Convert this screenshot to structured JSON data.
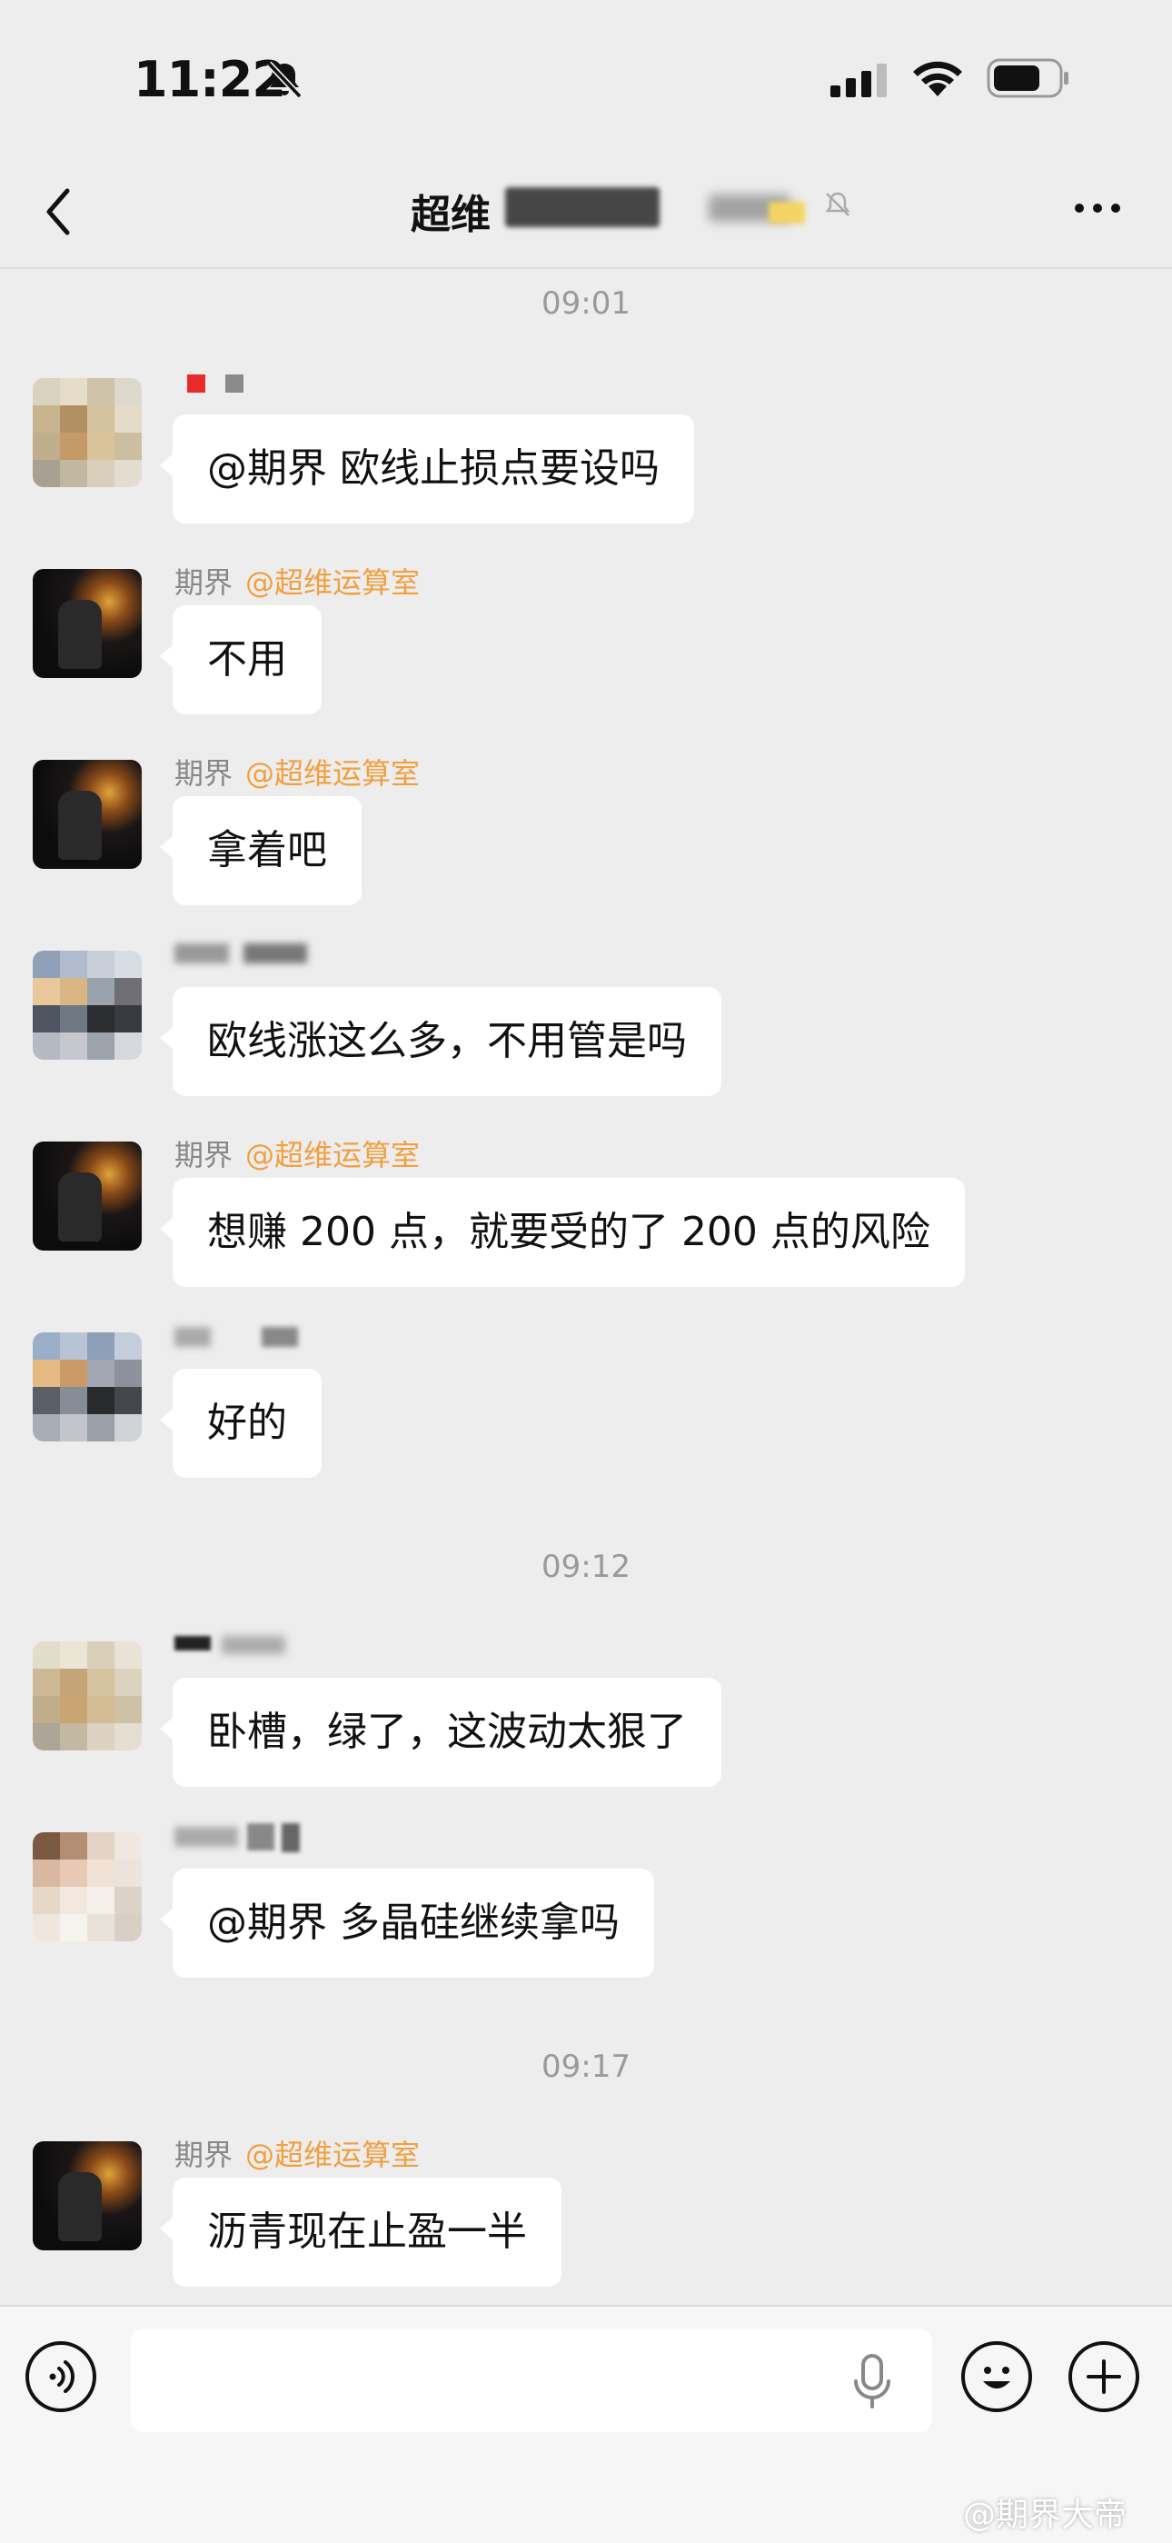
{
  "status_bar": {
    "time": "11:22",
    "icons": [
      "bell-slash-icon",
      "signal-icon",
      "wifi-icon",
      "battery-icon"
    ]
  },
  "nav": {
    "title_visible": "超维",
    "back_icon": "chevron-left-icon",
    "more_icon": "ellipsis-icon",
    "mute_icon": "bell-slash-icon"
  },
  "timestamps": [
    "09:01",
    "09:12",
    "09:17"
  ],
  "messages": [
    {
      "sender": "",
      "text": "@期界 欧线止损点要设吗"
    },
    {
      "sender": "期界",
      "tag": "@超维运算室",
      "text": "不用"
    },
    {
      "sender": "期界",
      "tag": "@超维运算室",
      "text": "拿着吧"
    },
    {
      "sender": "",
      "text": "欧线涨这么多，不用管是吗"
    },
    {
      "sender": "期界",
      "tag": "@超维运算室",
      "text": "想赚 200 点，就要受的了 200 点的风险"
    },
    {
      "sender": "",
      "text": "好的"
    },
    {
      "sender": "",
      "text": "卧槽，绿了，这波动太狠了"
    },
    {
      "sender": "",
      "text": "@期界 多晶硅继续拿吗"
    },
    {
      "sender": "期界",
      "tag": "@超维运算室",
      "text": "沥青现在止盈一半"
    }
  ],
  "input_bar": {
    "placeholder": "",
    "icons": [
      "voice-icon",
      "microphone-icon",
      "emoji-icon",
      "plus-icon"
    ]
  },
  "watermark": "@期界大帝",
  "colors": {
    "background": "#ededed",
    "bubble": "#ffffff",
    "tag": "#f0a040",
    "sender": "#888888"
  }
}
